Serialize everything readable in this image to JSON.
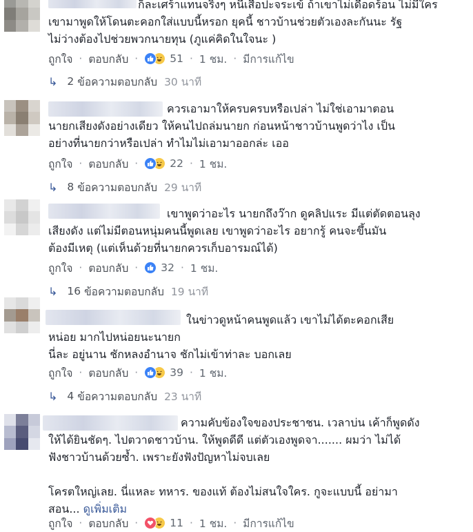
{
  "labels": {
    "like": "ถูกใจ",
    "reply": "ตอบกลับ",
    "replies_suffix": "ข้อความตอบกลับ",
    "edited": "มีการแก้ไข",
    "see_more": "ดูเพิ่มเติม"
  },
  "comments": [
    {
      "text": "ก็ละเศร้าแทนจริงๆ หนีเสือปะจระเข้ ถ้าเขาไม่เดือดร้อน ไม่มีใคร\nเขามาพูดให้โดนตะคอกใส่แบบนี้หรอก ยุคนี้ ชาวบ้านช่วยตัวเองละกันนะ รัฐ\nไม่ว่างต้องไปช่วยพวกนายทุน (ภูแค่คิดในใจนะ )",
      "reactions": "51",
      "time": "1 ชม.",
      "edited": "มีการแก้ไข",
      "reply_count": "2",
      "reply_time": "30 นาที",
      "avatar": [
        "#9a9a96",
        "#b8b7b2",
        "#d4d3ce",
        "#7f7d78",
        "#a6a49e",
        "#c9c8c3",
        "#8d8b86",
        "#b2b0ab",
        "#dedcd7"
      ]
    },
    {
      "text": "ควรเอามาให้ครบครบหรือเปล่า ไม่ใช่เอามาตอน\nนายกเสียงดังอย่างเดียว ให้คนไปถล่มนายก ก่อนหน้าชาวบ้านพูดว่าไง เป็น\nอย่างที่นายกว่าหรือเปล่า ทำไมไม่เอามาออกล่ะ เออ",
      "reactions": "22",
      "time": "1 ชม.",
      "reply_count": "8",
      "reply_time": "29 นาที",
      "avatar": [
        "#c8c3bc",
        "#9b8f82",
        "#d9d5cf",
        "#b9b2a8",
        "#8a7f72",
        "#cfc9c1",
        "#e2dfda",
        "#aca399",
        "#ebe9e5"
      ]
    },
    {
      "text": "เขาพูดว่าอะไร นายกถึงว๊าก ดูคลิปแระ มีแต่ตัดตอนลุง\nเสียงดัง แต่ไม่มีตอนหนุ่มคนนี้พูดเลย เขาพูดว่าอะไร อยากรู้ คนจะขึ้นมัน\nต้องมีเหตุ (แต่เห็นด้วยที่นายกควรเก็บอารมณ์ได้)",
      "reactions": "32",
      "time": "1 ชม.",
      "reply_count": "16",
      "reply_time": "19 นาที",
      "avatar": [
        "#e8e8e8",
        "#d2d2d2",
        "#f0f0f0",
        "#dcdcdc",
        "#c8c8c8",
        "#e4e4e4",
        "#f2f2f2",
        "#d6d6d6",
        "#ececec"
      ]
    },
    {
      "text": "ในข่าวดูหน้าคนพูดแล้ว เขาไม่ได้ตะคอกเสีย\nหน่อย มากไปหน่อยนะนายก\nนี่ละ อยู่นาน ชักหลงอำนาจ ชักไม่เข้าท่าละ บอกเลย",
      "reactions": "39",
      "time": "1 ชม.",
      "reply_count": "4",
      "reply_time": "23 นาที",
      "avatar": [
        "#e6e6e6",
        "#dadada",
        "#efefef",
        "#a39a90",
        "#9a7f6a",
        "#c9c4bd",
        "#e0e0e0",
        "#cfcfcf",
        "#ededed"
      ]
    },
    {
      "text": "ความคับข้องใจของประชาชน. เวลาบ่น เค้าก็พูดดัง\nให้ได้ยินชัดๆ. ไปตวาดชาวบ้าน. ให้พูดดีดี แต่ตัวเองพูดจา....... ผมว่า ไม่ได้\nฟังชาวบ้านด้วยซ้ำ. เพราะยังฟังปัญหาไม่จบเลย\n\nโครตใหญ่เลย. นี่แหละ ทหาร. ของแท้ ต้องไม่สนใจใคร. กูจะแบบนี้ อย่ามา\nสอน...",
      "reactions": "11",
      "time": "1 ชม.",
      "edited": "มีการแก้ไข",
      "avatar": [
        "#dfe1ea",
        "#7c7f99",
        "#c7cad9",
        "#b8bcd0",
        "#5a5d7e",
        "#d4d7e3",
        "#9ea2bd",
        "#474b70",
        "#e6e8ef"
      ]
    }
  ]
}
